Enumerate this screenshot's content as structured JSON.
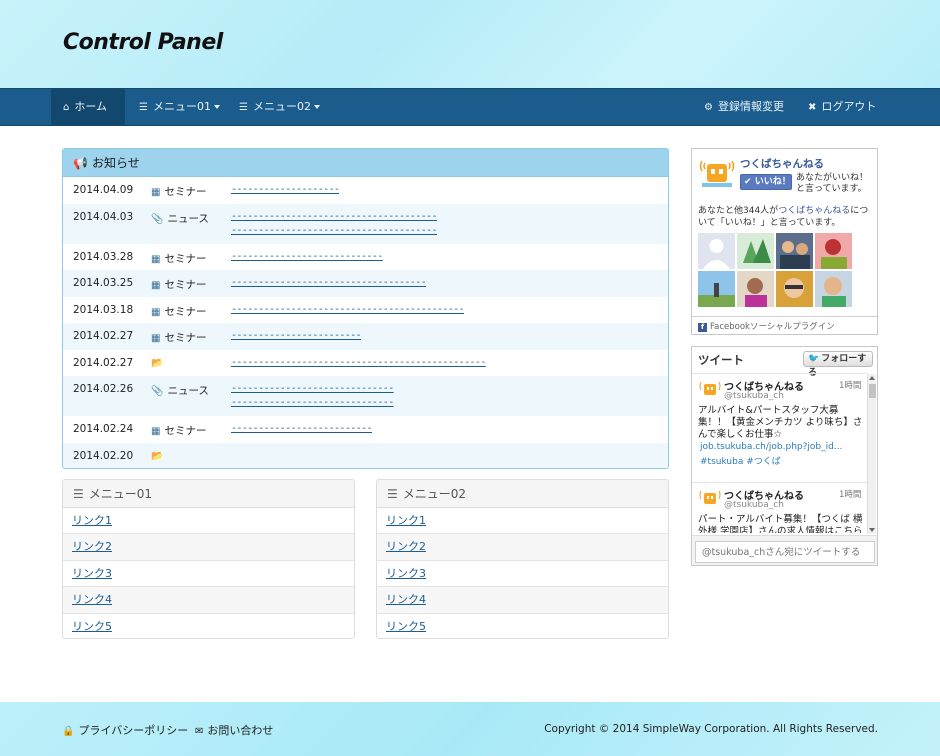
{
  "header": {
    "title": "Control Panel"
  },
  "navbar": {
    "items": [
      {
        "label": "ホーム"
      },
      {
        "label": "メニュー01"
      },
      {
        "label": "メニュー02"
      }
    ],
    "right": [
      {
        "label": "登録情報変更"
      },
      {
        "label": "ログアウト"
      }
    ]
  },
  "news": {
    "title": "お知らせ",
    "rows": [
      {
        "date": "2014.04.09",
        "category": "セミナー",
        "link": "--------------------"
      },
      {
        "date": "2014.04.03",
        "category": "ニュース",
        "link": "--------------------------------------\n--------------------------------------"
      },
      {
        "date": "2014.03.28",
        "category": "セミナー",
        "link": "----------------------------"
      },
      {
        "date": "2014.03.25",
        "category": "セミナー",
        "link": "------------------------------------"
      },
      {
        "date": "2014.03.18",
        "category": "セミナー",
        "link": "-------------------------------------------"
      },
      {
        "date": "2014.02.27",
        "category": "セミナー",
        "link": "------------------------"
      },
      {
        "date": "2014.02.27",
        "category": "",
        "link": "-----------------------------------------------"
      },
      {
        "date": "2014.02.26",
        "category": "ニュース",
        "link": "------------------------------\n------------------------------"
      },
      {
        "date": "2014.02.24",
        "category": "セミナー",
        "link": "--------------------------"
      },
      {
        "date": "2014.02.20",
        "category": "",
        "link": ""
      }
    ]
  },
  "menu01": {
    "title": "メニュー01",
    "links": [
      "リンク1",
      "リンク2",
      "リンク3",
      "リンク4",
      "リンク5"
    ]
  },
  "menu02": {
    "title": "メニュー02",
    "links": [
      "リンク1",
      "リンク2",
      "リンク3",
      "リンク4",
      "リンク5"
    ]
  },
  "facebook": {
    "page_name": "つくばちゃんねる",
    "like_button": "いいね！",
    "like_text": "あなたがいいね！と言っています。",
    "desc_prefix": "あなたと他344人が",
    "desc_link": "つくばちゃんねる",
    "desc_suffix": "について「いいね！」と言っています。",
    "footer": "Facebookソーシャルプラグイン"
  },
  "twitter": {
    "title": "ツイート",
    "follow_button": "フォローする",
    "tweets": [
      {
        "name": "つくばちゃんねる",
        "handle": "@tsukuba_ch",
        "time": "1時間",
        "text": "アルバイト&パートスタッフ大募集！！【黄金メンチカツ より味ち】さんで楽しくお仕事☆",
        "url": "job.tsukuba.ch/job.php?job_id...",
        "tags": "#tsukuba #つくば"
      },
      {
        "name": "つくばちゃんねる",
        "handle": "@tsukuba_ch",
        "time": "1時間",
        "text": "パート・アルバイト募集！【つくば 横外様 学園店】さんの求人情報はこちら",
        "url": "",
        "tags": ""
      }
    ],
    "input_placeholder": "@tsukuba_chさん宛にツイートする"
  },
  "footer": {
    "privacy": "プライバシーポリシー",
    "contact": "お問い合わせ",
    "copyright": "Copyright © 2014 SimpleWay Corporation. All Rights Reserved."
  },
  "colors": {
    "navbar": "#1b5c8c",
    "news_header": "#9dd3ec",
    "link": "#1d5d8f",
    "facebook": "#3b5998"
  }
}
